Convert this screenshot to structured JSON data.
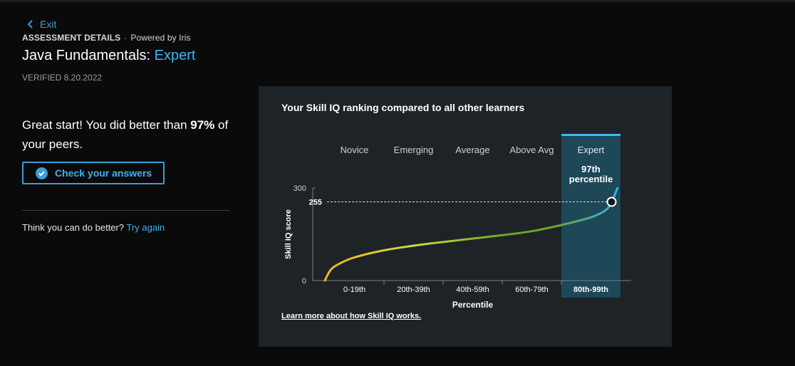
{
  "header": {
    "exit_label": "Exit",
    "section_label": "ASSESSMENT DETAILS",
    "separator": "·",
    "powered_by": "Powered by Iris",
    "title_prefix": "Java Fundamentals: ",
    "title_level": "Expert",
    "verified": "VERIFIED 8.20.2022"
  },
  "result": {
    "text_before": "Great start! You did better than ",
    "percent": "97%",
    "text_after": " of your peers.",
    "check_button_label": "Check your answers"
  },
  "retry": {
    "prompt": "Think you can do better?",
    "link_label": "Try again"
  },
  "card": {
    "title": "Your Skill IQ ranking compared to all other learners",
    "learn_more": "Learn more about how Skill IQ works."
  },
  "colors": {
    "accent": "#3fb7f3",
    "card_bg": "#1d2327",
    "highlight_bg": "#1e4757",
    "curve_start": "#f5b11d",
    "curve_mid": "#c6e03a",
    "curve_green": "#6da426",
    "curve_end": "#2fb4f0"
  },
  "chart_data": {
    "type": "line",
    "title": "Your Skill IQ ranking compared to all other learners",
    "xlabel": "Percentile",
    "ylabel": "Skill IQ score",
    "ylim": [
      0,
      300
    ],
    "y_ticks": [
      "300",
      "0"
    ],
    "categories": [
      "0-19th",
      "20th-39th",
      "40th-59th",
      "60th-79th",
      "80th-99th"
    ],
    "levels": [
      "Novice",
      "Emerging",
      "Average",
      "Above Avg",
      "Expert"
    ],
    "highlighted_index": 4,
    "marker": {
      "score": 255,
      "score_label": "255",
      "percentile": 97,
      "label_line1": "97th",
      "label_line2": "percentile"
    },
    "curve": {
      "x_percentile": [
        0,
        2,
        5,
        10,
        20,
        30,
        40,
        50,
        60,
        70,
        80,
        90,
        95,
        97,
        99
      ],
      "y_score": [
        0,
        35,
        55,
        75,
        98,
        113,
        125,
        136,
        147,
        160,
        180,
        205,
        228,
        255,
        300
      ]
    }
  }
}
